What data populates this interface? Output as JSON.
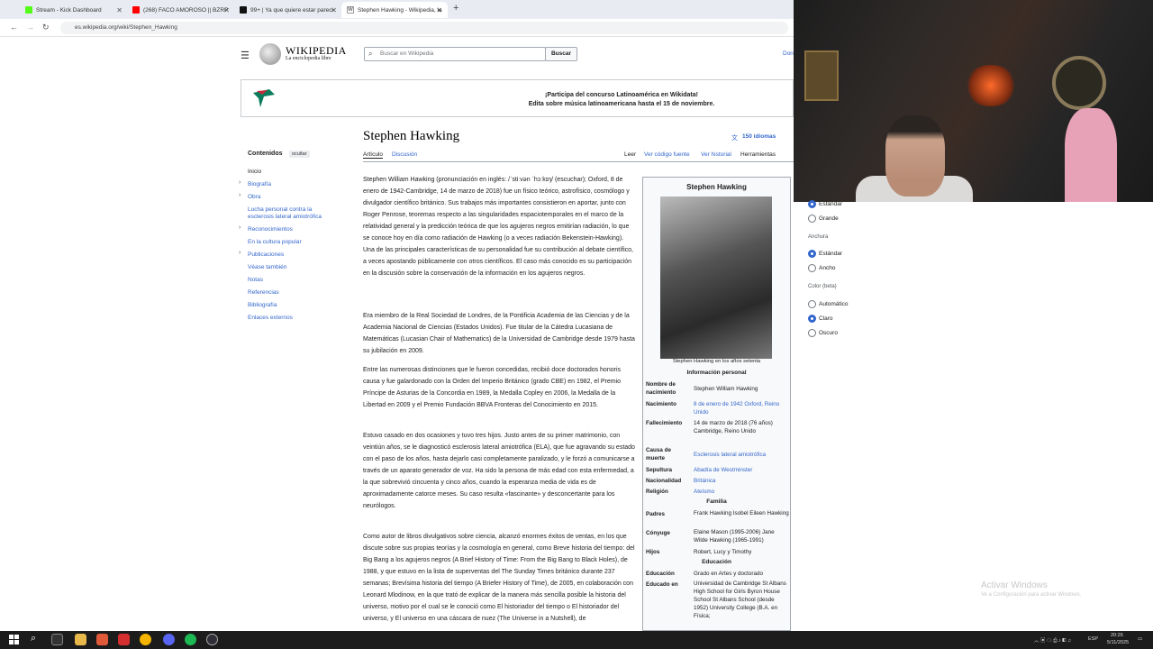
{
  "browser": {
    "tabs": [
      {
        "title": "Stream - Kick Dashboard",
        "color": "#53fc18"
      },
      {
        "title": "(268) FACO AMOROSO || BZRP",
        "color": "#ff0000"
      },
      {
        "title": "99+ | Ya que quiere estar pareci",
        "color": "#111111"
      },
      {
        "title": "Stephen Hawking - Wikipedia, la",
        "color": "#ffffff"
      }
    ],
    "url": "es.wikipedia.org/wiki/Stephen_Hawking"
  },
  "wiki": {
    "logo_title": "WIKIPEDIA",
    "logo_subtitle": "La enciclopedia libre",
    "search_placeholder": "Buscar en Wikipedia",
    "search_button": "Buscar",
    "top_right": "Don",
    "banner_line1": "¡Participa del concurso Latinoamérica en Wikidata!",
    "banner_line2": "Edita sobre música latinoamericana hasta el 15 de noviembre.",
    "toc_title": "Contenidos",
    "toc_hide": "ocultar",
    "toc_items": [
      "Inicio",
      "Biografía",
      "Obra",
      "Lucha personal contra la",
      "esclerosis lateral amiotrófica",
      "Reconocimientos",
      "En la cultura popular",
      "Publicaciones",
      "Véase también",
      "Notas",
      "Referencias",
      "Bibliografía",
      "Enlaces externos"
    ],
    "title": "Stephen Hawking",
    "languages": "150 idiomas",
    "tab_article": "Artículo",
    "tab_discussion": "Discusión",
    "tab_read": "Leer",
    "tab_edit_source": "Ver código fuente",
    "tab_history": "Ver historial",
    "tab_tools": "Herramientas",
    "paragraphs": [
      "Stephen William Hawking (pronunciación en inglés: /ˈstiːvən ˈhɔːkɪŋ/ (escuchar); Oxford, 8 de enero de 1942-Cambridge, 14 de marzo de 2018) fue un físico teórico, astrofísico, cosmólogo y divulgador científico británico. Sus trabajos más importantes consistieron en aportar, junto con Roger Penrose, teoremas respecto a las singularidades espaciotemporales en el marco de la relatividad general y la predicción teórica de que los agujeros negros emitirían radiación, lo que se conoce hoy en día como radiación de Hawking (o a veces radiación Bekenstein-Hawking). Una de las principales características de su personalidad fue su contribución al debate científico, a veces apostando públicamente con otros científicos. El caso más conocido es su participación en la discusión sobre la conservación de la información en los agujeros negros.",
      "Era miembro de la Real Sociedad de Londres, de la Pontificia Academia de las Ciencias y de la Academia Nacional de Ciencias (Estados Unidos). Fue titular de la Cátedra Lucasiana de Matemáticas (Lucasian Chair of Mathematics) de la Universidad de Cambridge desde 1979 hasta su jubilación en 2009.",
      "Entre las numerosas distinciones que le fueron concedidas, recibió doce doctorados honoris causa y fue galardonado con la Orden del Imperio Británico (grado CBE) en 1982, el Premio Príncipe de Asturias de la Concordia en 1989, la Medalla Copley en 2006, la Medalla de la Libertad en 2009 y el Premio Fundación BBVA Fronteras del Conocimiento en 2015.",
      "Estuvo casado en dos ocasiones y tuvo tres hijos. Justo antes de su primer matrimonio, con veintiún años, se le diagnosticó esclerosis lateral amiotrófica (ELA), que fue agravando su estado con el paso de los años, hasta dejarlo casi completamente paralizado, y le forzó a comunicarse a través de un aparato generador de voz. Ha sido la persona de más edad con esta enfermedad, a la que sobrevivió cincuenta y cinco años, cuando la esperanza media de vida es de aproximadamente catorce meses. Su caso resulta «fascinante» y desconcertante para los neurólogos.",
      "Como autor de libros divulgativos sobre ciencia, alcanzó enormes éxitos de ventas, en los que discute sobre sus propias teorías y la cosmología en general, como Breve historia del tiempo: del Big Bang a los agujeros negros (A Brief History of Time: From the Big Bang to Black Holes), de 1988, y que estuvo en la lista de superventas del The Sunday Times británico durante 237 semanas; Brevísima historia del tiempo (A Briefer History of Time), de 2005, en colaboración con Leonard Mlodinow, en la que trató de explicar de la manera más sencilla posible la historia del universo, motivo por el cual se le conoció como El historiador del tiempo o El historiador del universo, y El universo en una cáscara de nuez (The Universe in a Nutshell), de"
    ],
    "infobox": {
      "title": "Stephen Hawking",
      "caption": "Stephen Hawking en los años setenta",
      "section_personal": "Información personal",
      "section_family": "Familia",
      "section_education": "Educación",
      "rows": [
        {
          "label": "Nombre de nacimiento",
          "value": "Stephen William Hawking"
        },
        {
          "label": "Nacimiento",
          "value": "8 de enero de 1942 Oxford, Reino Unido"
        },
        {
          "label": "Fallecimiento",
          "value": "14 de marzo de 2018 (76 años) Cambridge, Reino Unido"
        },
        {
          "label": "Causa de muerte",
          "value": "Esclerosis lateral amiotrófica"
        },
        {
          "label": "Sepultura",
          "value": "Abadía de Westminster"
        },
        {
          "label": "Nacionalidad",
          "value": "Británica"
        },
        {
          "label": "Religión",
          "value": "Ateísmo"
        },
        {
          "label": "Padres",
          "value": "Frank Hawking Isobel Eileen Hawking"
        },
        {
          "label": "Cónyuge",
          "value": "Elaine Mason (1995-2006) Jane Wilde Hawking (1965-1991)"
        },
        {
          "label": "Hijos",
          "value": "Robert, Lucy y Timothy"
        },
        {
          "label": "Educación",
          "value": "Grado en Artes y doctorado"
        },
        {
          "label": "Educado en",
          "value": "Universidad de Cambridge St Albans High School for Girls Byron House School St Albans School (desde 1952) University College (B.A. en Física;"
        }
      ]
    }
  },
  "appearance_panel": {
    "size_option_1": "Estándar",
    "size_option_2": "Grande",
    "width_label": "Anchura",
    "width_option_1": "Estándar",
    "width_option_2": "Ancho",
    "color_label": "Color (beta)",
    "color_option_1": "Automático",
    "color_option_2": "Claro",
    "color_option_3": "Oscuro"
  },
  "watermark": {
    "line1": "Activar Windows",
    "line2": "Ve a Configuración para activar Windows."
  },
  "taskbar": {
    "lang": "ESP",
    "time": "20:26",
    "date": "5/11/2025"
  }
}
